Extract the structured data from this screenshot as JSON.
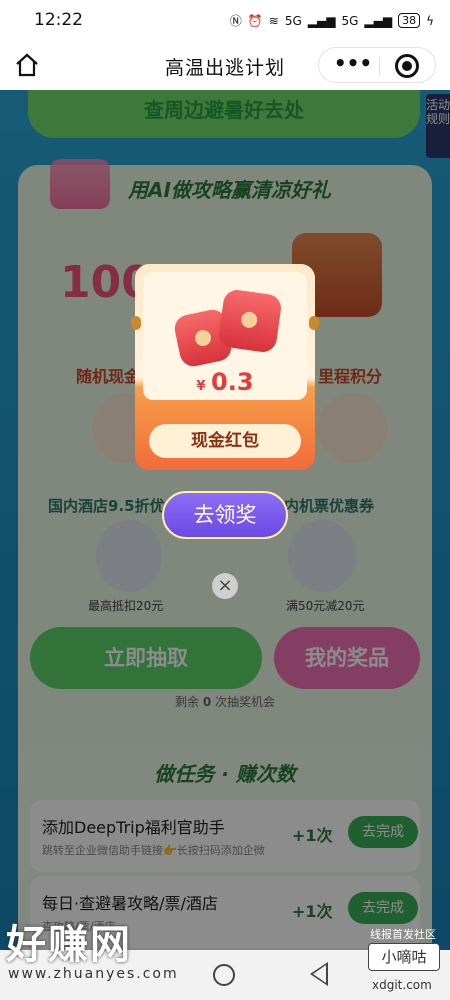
{
  "status_bar": {
    "time": "12:22",
    "signal_1": "5G",
    "signal_2": "5G",
    "battery": "38"
  },
  "nav": {
    "title": "高温出逃计划",
    "more": "•••",
    "home_icon": "home-icon",
    "capsule_icon": "target-icon"
  },
  "page": {
    "top_button": "查周边避暑好去处",
    "rules_tab": "活动规则",
    "card1": {
      "title": "用AI做攻略赢清凉好礼",
      "big_number": "100",
      "prize_left": "随机现金",
      "prize_right": "里程积分",
      "hotel_title": "国内酒店9.5折优",
      "hotel_sub": "最高抵扣20元",
      "flight_title": "内机票优惠券",
      "flight_sub": "满50元减20元",
      "draw_button": "立即抽取",
      "myprize_button": "我的奖品",
      "chances_prefix": "剩余",
      "chances_count": "0",
      "chances_suffix": "次抽奖机会"
    },
    "card2": {
      "title": "做任务 · 赚次数",
      "tasks": [
        {
          "title": "添加DeepTrip福利官助手",
          "sub": "跳转至企业微信助手链接👉长按扫码添加企微",
          "reward": "+1次",
          "button": "去完成"
        },
        {
          "title": "每日·查避暑攻略/票/酒店",
          "sub": "查攻略/票/酒店",
          "reward": "+1次",
          "button": "去完成"
        }
      ]
    }
  },
  "popup": {
    "currency": "¥",
    "amount": "0.3",
    "label": "现金红包",
    "claim_button": "去领奖",
    "close": "×"
  },
  "watermark": {
    "left": "好赚网",
    "left_url": "www.zhuanyes.com",
    "right_top": "线报首发社区",
    "right_box": "小嘀咕",
    "right_url": "xdgit.com"
  },
  "colors": {
    "page_bg": "#1e93c8",
    "green_button": "#5bd26b",
    "pink_button": "#f272b4",
    "claim_purple": "#6a49e6",
    "red_envelope": "#d8323c"
  }
}
